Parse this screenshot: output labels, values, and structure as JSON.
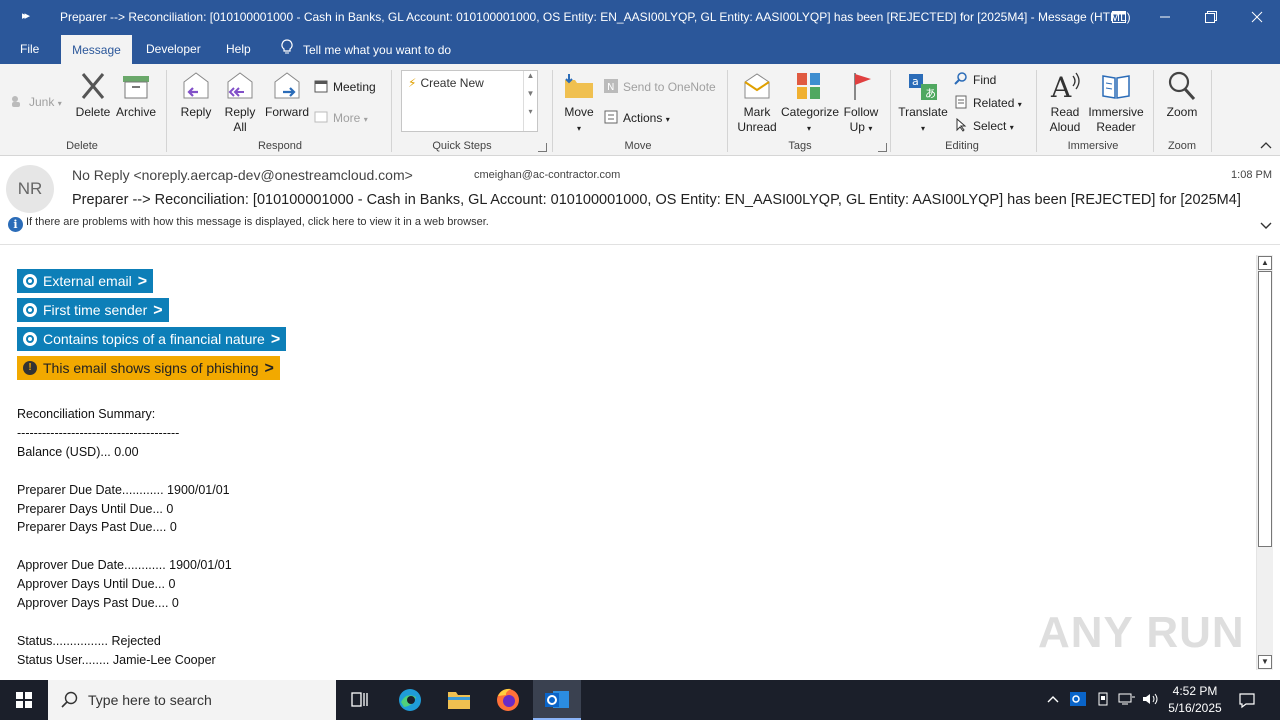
{
  "window": {
    "title": "Preparer --> Reconciliation: [010100001000 - Cash in Banks, GL Account: 010100001000, OS Entity: EN_AASI00LYQP, GL Entity: AASI00LYQP] has been [REJECTED] for [2025M4]  -  Message (HTML)"
  },
  "menu": {
    "tabs": [
      "File",
      "Message",
      "Developer",
      "Help"
    ],
    "active_tab": "Message",
    "tell_me": "Tell me what you want to do"
  },
  "ribbon": {
    "delete_group": {
      "junk": "Junk",
      "delete": "Delete",
      "archive": "Archive",
      "label": "Delete"
    },
    "respond_group": {
      "reply": "Reply",
      "reply_all_line1": "Reply",
      "reply_all_line2": "All",
      "forward": "Forward",
      "meeting": "Meeting",
      "more": "More",
      "label": "Respond"
    },
    "quick_steps": {
      "create_new": "Create New",
      "label": "Quick Steps"
    },
    "move_group": {
      "move": "Move",
      "send_to_onenote": "Send to OneNote",
      "actions": "Actions",
      "label": "Move"
    },
    "tags_group": {
      "mark_unread_line1": "Mark",
      "mark_unread_line2": "Unread",
      "categorize": "Categorize",
      "follow_up_line1": "Follow",
      "follow_up_line2": "Up",
      "label": "Tags"
    },
    "editing_group": {
      "translate": "Translate",
      "find": "Find",
      "related": "Related",
      "select": "Select",
      "label": "Editing"
    },
    "immersive_group": {
      "read_aloud_line1": "Read",
      "read_aloud_line2": "Aloud",
      "immersive_reader_line1": "Immersive",
      "immersive_reader_line2": "Reader",
      "label": "Immersive"
    },
    "zoom_group": {
      "zoom": "Zoom",
      "label": "Zoom"
    }
  },
  "message": {
    "avatar_initials": "NR",
    "from": "No Reply <noreply.aercap-dev@onestreamcloud.com>",
    "to": "cmeighan@ac-contractor.com",
    "time": "1:08 PM",
    "subject": "Preparer --> Reconciliation: [010100001000 - Cash in Banks, GL Account: 010100001000, OS Entity: EN_AASI00LYQP, GL Entity: AASI00LYQP] has been [REJECTED] for [2025M4]",
    "info_bar": "If there are problems with how this message is displayed, click here to view it in a web browser."
  },
  "banners": [
    {
      "text": "External email",
      "kind": "blue"
    },
    {
      "text": "First time sender",
      "kind": "blue"
    },
    {
      "text": "Contains topics of a financial nature",
      "kind": "blue"
    },
    {
      "text": "This email  shows signs of phishing",
      "kind": "yellow"
    }
  ],
  "body_lines": {
    "l1": "Reconciliation Summary:",
    "l2": "---------------------------------------",
    "l3": "Balance (USD)... 0.00",
    "l4": "Preparer Due Date............ 1900/01/01",
    "l5": "Preparer Days Until Due... 0",
    "l6": "Preparer Days Past Due.... 0",
    "l7": "Approver Due Date............ 1900/01/01",
    "l8": "Approver Days Until Due... 0",
    "l9": "Approver Days Past Due.... 0",
    "l10": "Status................ Rejected",
    "l11": "Status User........ Jamie-Lee Cooper"
  },
  "taskbar": {
    "search_placeholder": "Type here to search",
    "time": "4:52 PM",
    "date": "5/16/2025"
  },
  "watermark": "ANY RUN",
  "colors": {
    "titlebar": "#2b579a",
    "banner_blue": "#0d7fb8",
    "banner_yellow": "#f2a900",
    "taskbar": "#1b1f2a"
  }
}
